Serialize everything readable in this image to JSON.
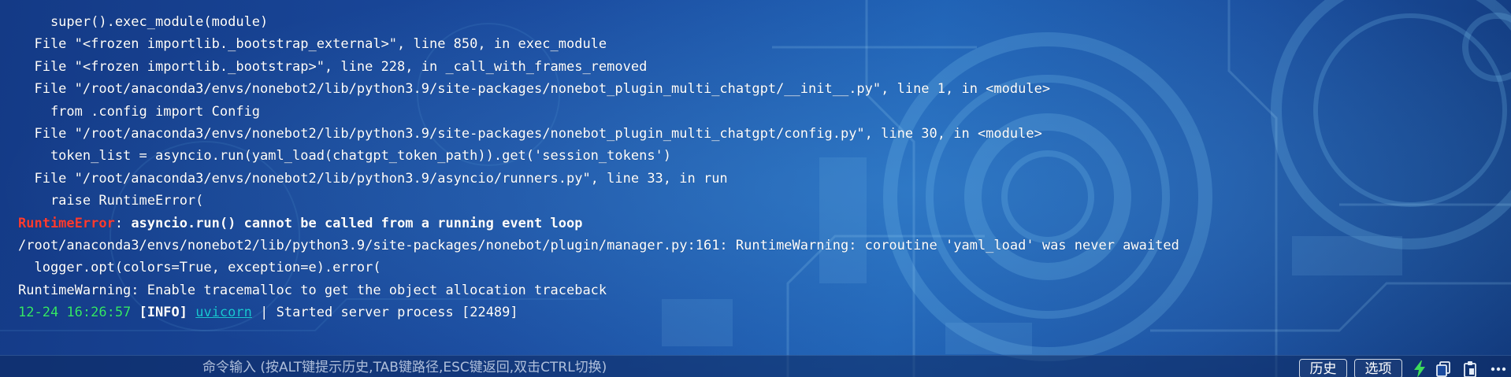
{
  "terminal": {
    "lines": [
      "    super().exec_module(module)",
      "  File \"<frozen importlib._bootstrap_external>\", line 850, in exec_module",
      "  File \"<frozen importlib._bootstrap>\", line 228, in _call_with_frames_removed",
      "  File \"/root/anaconda3/envs/nonebot2/lib/python3.9/site-packages/nonebot_plugin_multi_chatgpt/__init__.py\", line 1, in <module>",
      "    from .config import Config",
      "  File \"/root/anaconda3/envs/nonebot2/lib/python3.9/site-packages/nonebot_plugin_multi_chatgpt/config.py\", line 30, in <module>",
      "    token_list = asyncio.run(yaml_load(chatgpt_token_path)).get('session_tokens')",
      "  File \"/root/anaconda3/envs/nonebot2/lib/python3.9/asyncio/runners.py\", line 33, in run",
      "    raise RuntimeError("
    ],
    "error_name": "RuntimeError",
    "error_sep": ": ",
    "error_message": "asyncio.run() cannot be called from a running event loop",
    "warning_line": "/root/anaconda3/envs/nonebot2/lib/python3.9/site-packages/nonebot/plugin/manager.py:161: RuntimeWarning: coroutine 'yaml_load' was never awaited",
    "logger_line": "  logger.opt(colors=True, exception=e).error(",
    "tracemalloc_line": "RuntimeWarning: Enable tracemalloc to get the object allocation traceback",
    "log": {
      "timestamp": "12-24 16:26:57",
      "level": "[INFO]",
      "module": "uvicorn",
      "separator": " | ",
      "message": "Started server process [22489]"
    }
  },
  "command_bar": {
    "placeholder": "命令输入 (按ALT键提示历史,TAB键路径,ESC键返回,双击CTRL切换)",
    "history_label": "历史",
    "options_label": "选项"
  },
  "colors": {
    "error": "#ff3b30",
    "timestamp": "#34e86a",
    "module_link": "#19c7d6",
    "bolt": "#3ddc5a"
  },
  "icons": [
    "lightning-bolt-icon",
    "copy-icon",
    "paste-icon",
    "more-icon"
  ]
}
